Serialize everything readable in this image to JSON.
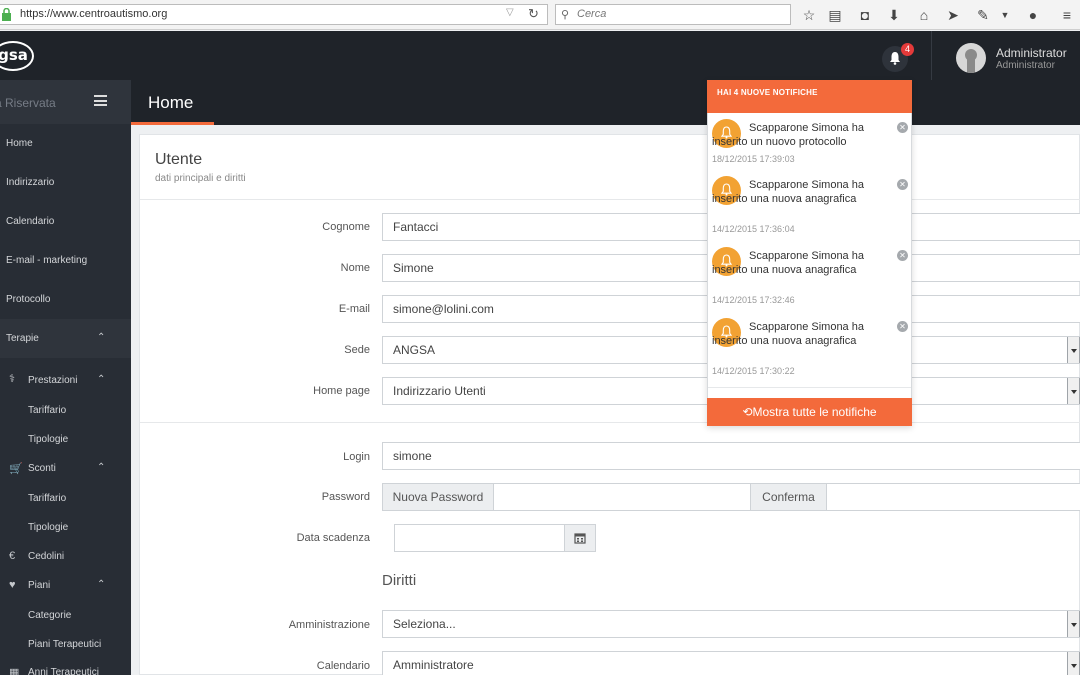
{
  "browser": {
    "url": "https://www.centroautismo.org",
    "search_placeholder": "Cerca"
  },
  "header": {
    "logo_text": "gsa",
    "notification_count": "4",
    "user_name": "Administrator",
    "user_role": "Administrator"
  },
  "sidebar": {
    "title": "a Riservata",
    "items": [
      {
        "label": "Home"
      },
      {
        "label": "Indirizzario"
      },
      {
        "label": "Calendario"
      },
      {
        "label": "E-mail - marketing"
      },
      {
        "label": "Protocollo"
      },
      {
        "label": "Terapie"
      },
      {
        "label": "Prestazioni"
      },
      {
        "label": "Tariffario"
      },
      {
        "label": "Tipologie"
      },
      {
        "label": "Sconti"
      },
      {
        "label": "Tariffario"
      },
      {
        "label": "Tipologie"
      },
      {
        "label": "Cedolini"
      },
      {
        "label": "Piani"
      },
      {
        "label": "Categorie"
      },
      {
        "label": "Piani Terapeutici"
      },
      {
        "label": "Anni Terapeutici"
      }
    ]
  },
  "page": {
    "title": "Home"
  },
  "card": {
    "title": "Utente",
    "subtitle": "dati principali e diritti",
    "fields": {
      "cognome": {
        "label": "Cognome",
        "value": "Fantacci"
      },
      "nome": {
        "label": "Nome",
        "value": "Simone"
      },
      "email": {
        "label": "E-mail",
        "value": "simone@lolini.com"
      },
      "sede": {
        "label": "Sede",
        "value": "ANGSA"
      },
      "homepage": {
        "label": "Home page",
        "value": "Indirizzario Utenti"
      },
      "login": {
        "label": "Login",
        "value": "simone"
      },
      "password": {
        "label": "Password",
        "addon_new": "Nuova Password",
        "addon_confirm": "Conferma"
      },
      "scadenza": {
        "label": "Data scadenza",
        "value": ""
      }
    },
    "rights_title": "Diritti",
    "rights": {
      "amministrazione": {
        "label": "Amministrazione",
        "value": "Seleziona..."
      },
      "calendario": {
        "label": "Calendario",
        "value": "Amministratore"
      }
    }
  },
  "notifications": {
    "header": "HAI 4 NUOVE NOTIFICHE",
    "items": [
      {
        "text": "Scapparone Simona ha inserito un nuovo protocollo",
        "time": "18/12/2015 17:39:03"
      },
      {
        "text": "Scapparone Simona ha inserito una nuova anagrafica",
        "time": "14/12/2015 17:36:04"
      },
      {
        "text": "Scapparone Simona ha inserito una nuova anagrafica",
        "time": "14/12/2015 17:32:46"
      },
      {
        "text": "Scapparone Simona ha inserito una nuova anagrafica",
        "time": "14/12/2015 17:30:22"
      }
    ],
    "footer": "Mostra tutte le notifiche"
  },
  "colors": {
    "accent": "#f36a3b",
    "notif_icon": "#f2a233",
    "badge": "#e43a3a",
    "dark_bg": "#1f2329",
    "sidebar_bg": "#282d35"
  }
}
